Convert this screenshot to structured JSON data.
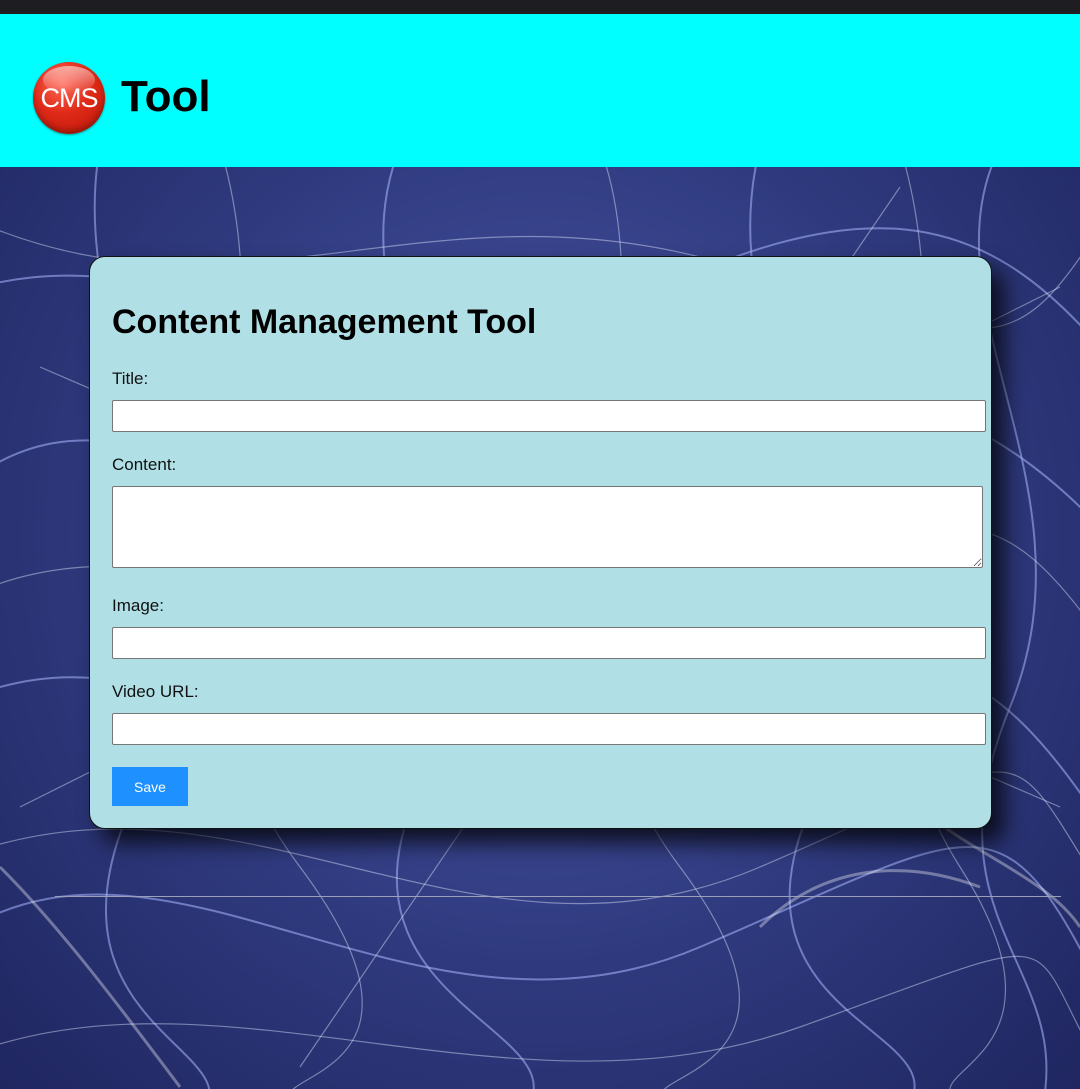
{
  "header": {
    "logo_text": "CMS",
    "app_title": "Tool",
    "background_color": "#00ffff"
  },
  "form": {
    "heading": "Content Management Tool",
    "title_label": "Title:",
    "title_value": "",
    "content_label": "Content:",
    "content_value": "",
    "image_label": "Image:",
    "image_value": "",
    "video_label": "Video URL:",
    "video_value": "",
    "save_label": "Save",
    "card_color": "#b0e0e6",
    "button_color": "#1e90ff"
  }
}
